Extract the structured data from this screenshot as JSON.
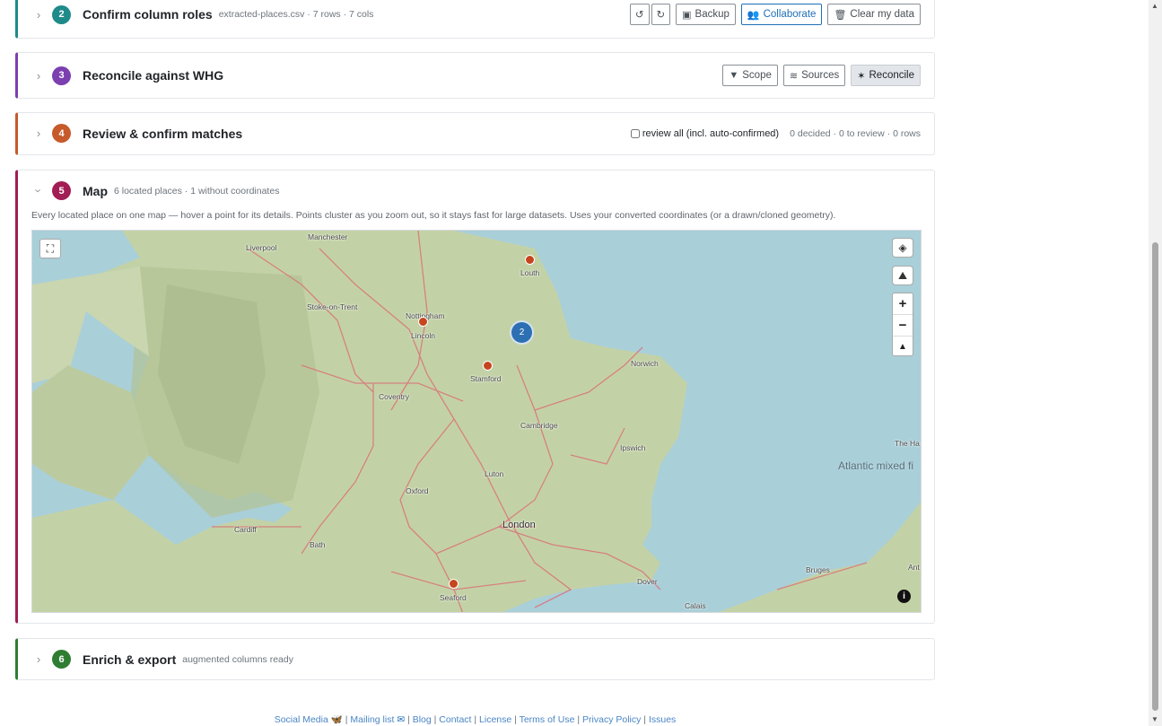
{
  "panels": {
    "confirm": {
      "number": "2",
      "title": "Confirm column roles",
      "sub": "extracted-places.csv · 7 rows · 7 cols",
      "buttons": {
        "undo": "↺",
        "redo": "↻",
        "backup": "Backup",
        "collaborate": "Collaborate",
        "clear": "Clear my data"
      }
    },
    "reconcile": {
      "number": "3",
      "title": "Reconcile against WHG",
      "buttons": {
        "scope": "Scope",
        "sources": "Sources",
        "reconcile": "Reconcile"
      }
    },
    "review": {
      "number": "4",
      "title": "Review & confirm matches",
      "checkbox_label": "review all (incl. auto-confirmed)",
      "status": "0 decided · 0 to review · 0 rows"
    },
    "map": {
      "number": "5",
      "title": "Map",
      "sub": "6 located places · 1 without coordinates",
      "description": "Every located place on one map — hover a point for its details. Points cluster as you zoom out, so it stays fast for large datasets. Uses your converted coordinates (or a drawn/cloned geometry).",
      "cluster_count": "2",
      "labels": {
        "liverpool": "Liverpool",
        "manchester": "Manchester",
        "stoke": "Stoke-on-Trent",
        "nottingham": "Nottingham",
        "lincoln": "Lincoln",
        "louth": "Louth",
        "norwich": "Norwich",
        "stamford": "Stamford",
        "coventry": "Coventry",
        "cambridge": "Cambridge",
        "ipswich": "Ipswich",
        "luton": "Luton",
        "oxford": "Oxford",
        "london": "London",
        "cardiff": "Cardiff",
        "bath": "Bath",
        "seaford": "Seaford",
        "dover": "Dover",
        "calais": "Calais",
        "bruges": "Bruges",
        "ant": "Ant",
        "thehague": "The Ha",
        "sea": "Atlantic mixed fi"
      }
    },
    "enrich": {
      "number": "6",
      "title": "Enrich & export",
      "sub": "augmented columns ready"
    }
  },
  "colors": {
    "teal": "#1f8a8a",
    "purple": "#7b3fb0",
    "orange": "#c65a2a",
    "crimson": "#a11d54",
    "green": "#2e7d32",
    "blue": "#1f6fb7"
  },
  "footer": {
    "social": "Social Media",
    "mailing": "Mailing list",
    "blog": "Blog",
    "contact": "Contact",
    "license": "License",
    "terms": "Terms of Use",
    "privacy": "Privacy Policy",
    "issues": "Issues"
  }
}
